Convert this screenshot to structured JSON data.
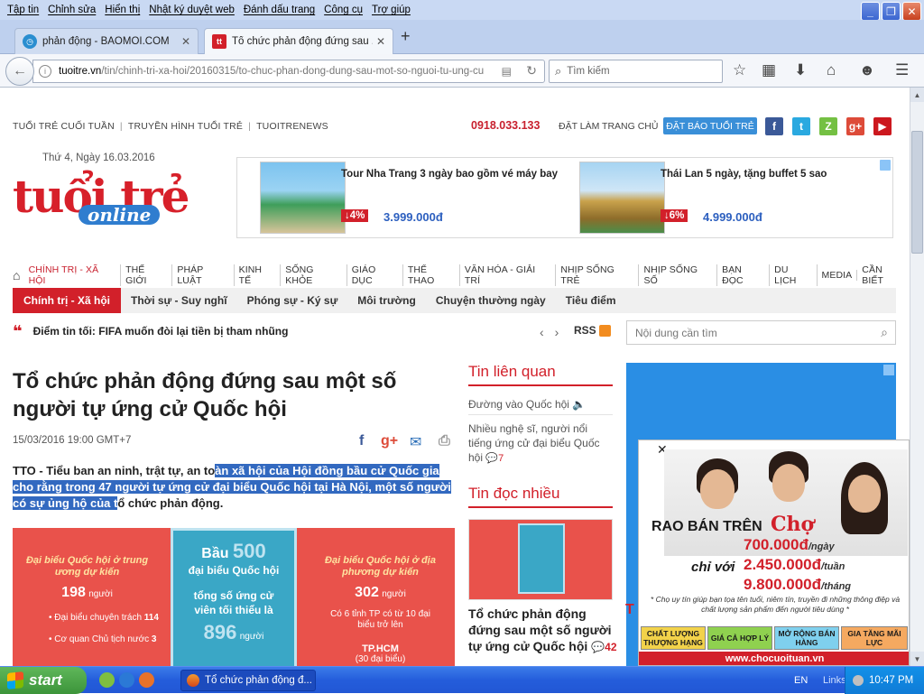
{
  "menubar": [
    "Tập tin",
    "Chỉnh sửa",
    "Hiển thị",
    "Nhật ký duyệt web",
    "Đánh dấu trang",
    "Công cụ",
    "Trợ giúp"
  ],
  "tabs": [
    {
      "label": "phản động - BAOMOI.COM",
      "icon": "baomoi-favicon"
    },
    {
      "label": "Tổ chức phản động đứng sau ...",
      "icon": "tuoitre-favicon",
      "active": true
    }
  ],
  "url": {
    "host": "tuoitre.vn",
    "path": "/tin/chinh-tri-xa-hoi/20160315/to-chuc-phan-dong-dung-sau-mot-so-nguoi-tu-ung-cu"
  },
  "search": {
    "placeholder": "Tìm kiếm"
  },
  "site": {
    "toplinks": [
      "TUỔI TRẺ CUỐI TUẦN",
      "TRUYỀN HÌNH TUỔI TRẺ",
      "TUOITRENEWS"
    ],
    "hotline": "0918.033.133",
    "homepage": "ĐẶT LÀM TRANG CHỦ",
    "subscribe": "ĐẶT BÁO TUỔI TRẺ",
    "date": "Thứ 4, Ngày 16.03.2016",
    "logo_main": "tuổi trẻ",
    "logo_sub": "online",
    "social": [
      {
        "name": "facebook-icon",
        "glyph": "f",
        "color": "#3b5998"
      },
      {
        "name": "twitter-icon",
        "glyph": "t",
        "color": "#2aa9e0"
      },
      {
        "name": "zing-icon",
        "glyph": "Z",
        "color": "#74c043"
      },
      {
        "name": "googleplus-icon",
        "glyph": "g+",
        "color": "#dd4b39"
      },
      {
        "name": "youtube-icon",
        "glyph": "▶",
        "color": "#cc181e"
      }
    ]
  },
  "ad_top": [
    {
      "title": "Tour Nha Trang 3 ngày bao gồm vé máy bay",
      "discount": "↓4%",
      "price": "3.999.000đ"
    },
    {
      "title": "Thái Lan 5 ngày, tặng buffet 5 sao",
      "discount": "↓6%",
      "price": "4.999.000đ"
    }
  ],
  "mainnav": [
    "CHÍNH TRỊ - XÃ HỘI",
    "THẾ GIỚI",
    "PHÁP LUẬT",
    "KINH TẾ",
    "SỐNG KHỎE",
    "GIÁO DỤC",
    "THỂ THAO",
    "VĂN HÓA - GIẢI TRÍ",
    "NHỊP SỐNG TRẺ",
    "NHỊP SỐNG SỐ",
    "BẠN ĐỌC",
    "DU LỊCH",
    "MEDIA",
    "CẦN BIẾT"
  ],
  "subnav": {
    "active": "Chính trị - Xã hội",
    "items": [
      "Thời sự - Suy nghĩ",
      "Phóng sự - Ký sự",
      "Môi trường",
      "Chuyện thường ngày",
      "Tiêu điểm"
    ]
  },
  "ticker": {
    "text": "Điểm tin tối: FIFA muốn đòi lại tiền bị tham nhũng",
    "rss": "RSS"
  },
  "site_search": {
    "placeholder": "Nội dung cần tìm"
  },
  "article": {
    "title": "Tổ chức phản động đứng sau một số người tự ứng cử Quốc hội",
    "time": "15/03/2016 19:00 GMT+7",
    "lead_pre": "TTO - Tiểu ban an ninh, trật tự, an to",
    "lead_hl": "àn xã hội của Hội đồng bầu cử Quốc gia cho rằng trong 47 người tự ứng cử đại biểu Quốc hội tại Hà Nội, một số người có sự ủng hộ của t",
    "lead_post": "ổ chức phản động."
  },
  "infographic": {
    "left_h": "Đại biểu Quốc hội ở trung ương dự kiến",
    "left_n": "198",
    "left_unit": "người",
    "left_a": "Đại biểu chuyên trách",
    "left_a_n": "114",
    "left_b": "Cơ quan Chủ tịch nước",
    "left_b_n": "3",
    "mid_h": "Bầu",
    "mid_n": "500",
    "mid_s": "đại biểu Quốc hội",
    "mid_t": "tổng số ứng cử viên tối thiểu là",
    "mid_n2": "896",
    "mid_unit": "người",
    "right_h": "Đại biểu Quốc hội ở địa phương dự kiến",
    "right_n": "302",
    "right_unit": "người",
    "right_s": "Có 6 tỉnh TP có từ 10 đại biểu trở lên",
    "right_city": "TP.HCM",
    "right_city_n": "(30 đại biểu)"
  },
  "related": {
    "heading": "Tin liên quan",
    "items": [
      {
        "text": "Đường vào Quốc hội",
        "comments": ""
      },
      {
        "text": "Nhiều nghệ sĩ, người nổi tiếng ứng cử đại biểu Quốc hội",
        "comments": "7"
      }
    ]
  },
  "popular": {
    "heading": "Tin đọc nhiều",
    "title": "Tổ chức phản động đứng sau một số người tự ứng cử Quốc hội",
    "comments": "42"
  },
  "popup_ad": {
    "rao": "RAO BÁN TRÊN",
    "cho": "Chợ",
    "chi": "chỉ với",
    "prices": [
      {
        "v": "700.000đ",
        "u": "/ngày"
      },
      {
        "v": "2.450.000đ",
        "u": "/tuần"
      },
      {
        "v": "9.800.000đ",
        "u": "/tháng"
      }
    ],
    "note": "* Chọ uy tín giúp bạn tọa tên tuổi, niêm tín, truyền đi những thông điệp và chất lượng sản phẩm đến người tiêu dùng *",
    "ctas": [
      "CHẤT LƯỢNG THƯỢNG HẠNG",
      "GIÁ CẢ HỢP LÝ",
      "MỞ RỘNG BÁN HÀNG",
      "GIA TĂNG MÃI LỰC"
    ],
    "url": "www.chocuoituan.vn"
  },
  "taskbar": {
    "start": "start",
    "task": "Tổ chức phản động đ...",
    "lang": "EN",
    "links": "Links",
    "time": "10:47 PM"
  }
}
